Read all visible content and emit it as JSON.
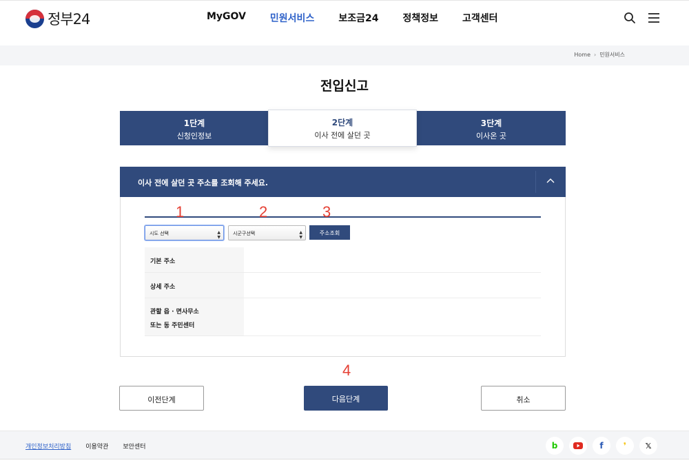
{
  "header": {
    "logo_text": "정부24",
    "nav": [
      "MyGOV",
      "민원서비스",
      "보조금24",
      "정책정보",
      "고객센터"
    ],
    "active_nav": "민원서비스"
  },
  "breadcrumb": {
    "home": "Home",
    "current": "민원서비스"
  },
  "page_title": "전입신고",
  "steps": [
    {
      "num": "1단계",
      "label": "신청인정보"
    },
    {
      "num": "2단계",
      "label": "이사 전에 살던 곳"
    },
    {
      "num": "3단계",
      "label": "이사온 곳"
    }
  ],
  "panel": {
    "title": "이사 전에 살던 곳 주소를 조회해 주세요.",
    "sido_select": "시도 선택",
    "sigungu_select": "시군구선택",
    "search_button": "주소조회",
    "rows": {
      "basic": "기본 주소",
      "detail": "상세 주소",
      "office_line1": "관할 읍 · 면사무소",
      "office_line2": "또는 동 주민센터"
    }
  },
  "annotations": [
    "1",
    "2",
    "3",
    "4"
  ],
  "buttons": {
    "prev": "이전단계",
    "next": "다음단계",
    "cancel": "취소"
  },
  "footer": {
    "links": [
      "개인정보처리방침",
      "이용약관",
      "보안센터"
    ],
    "sns_icons": [
      "blog-icon",
      "youtube-icon",
      "facebook-icon",
      "kakao-story-icon",
      "x-icon"
    ]
  },
  "colors": {
    "primary": "#304a7c",
    "accent_blue": "#2f62c9",
    "annotation_red": "#e53f33"
  }
}
